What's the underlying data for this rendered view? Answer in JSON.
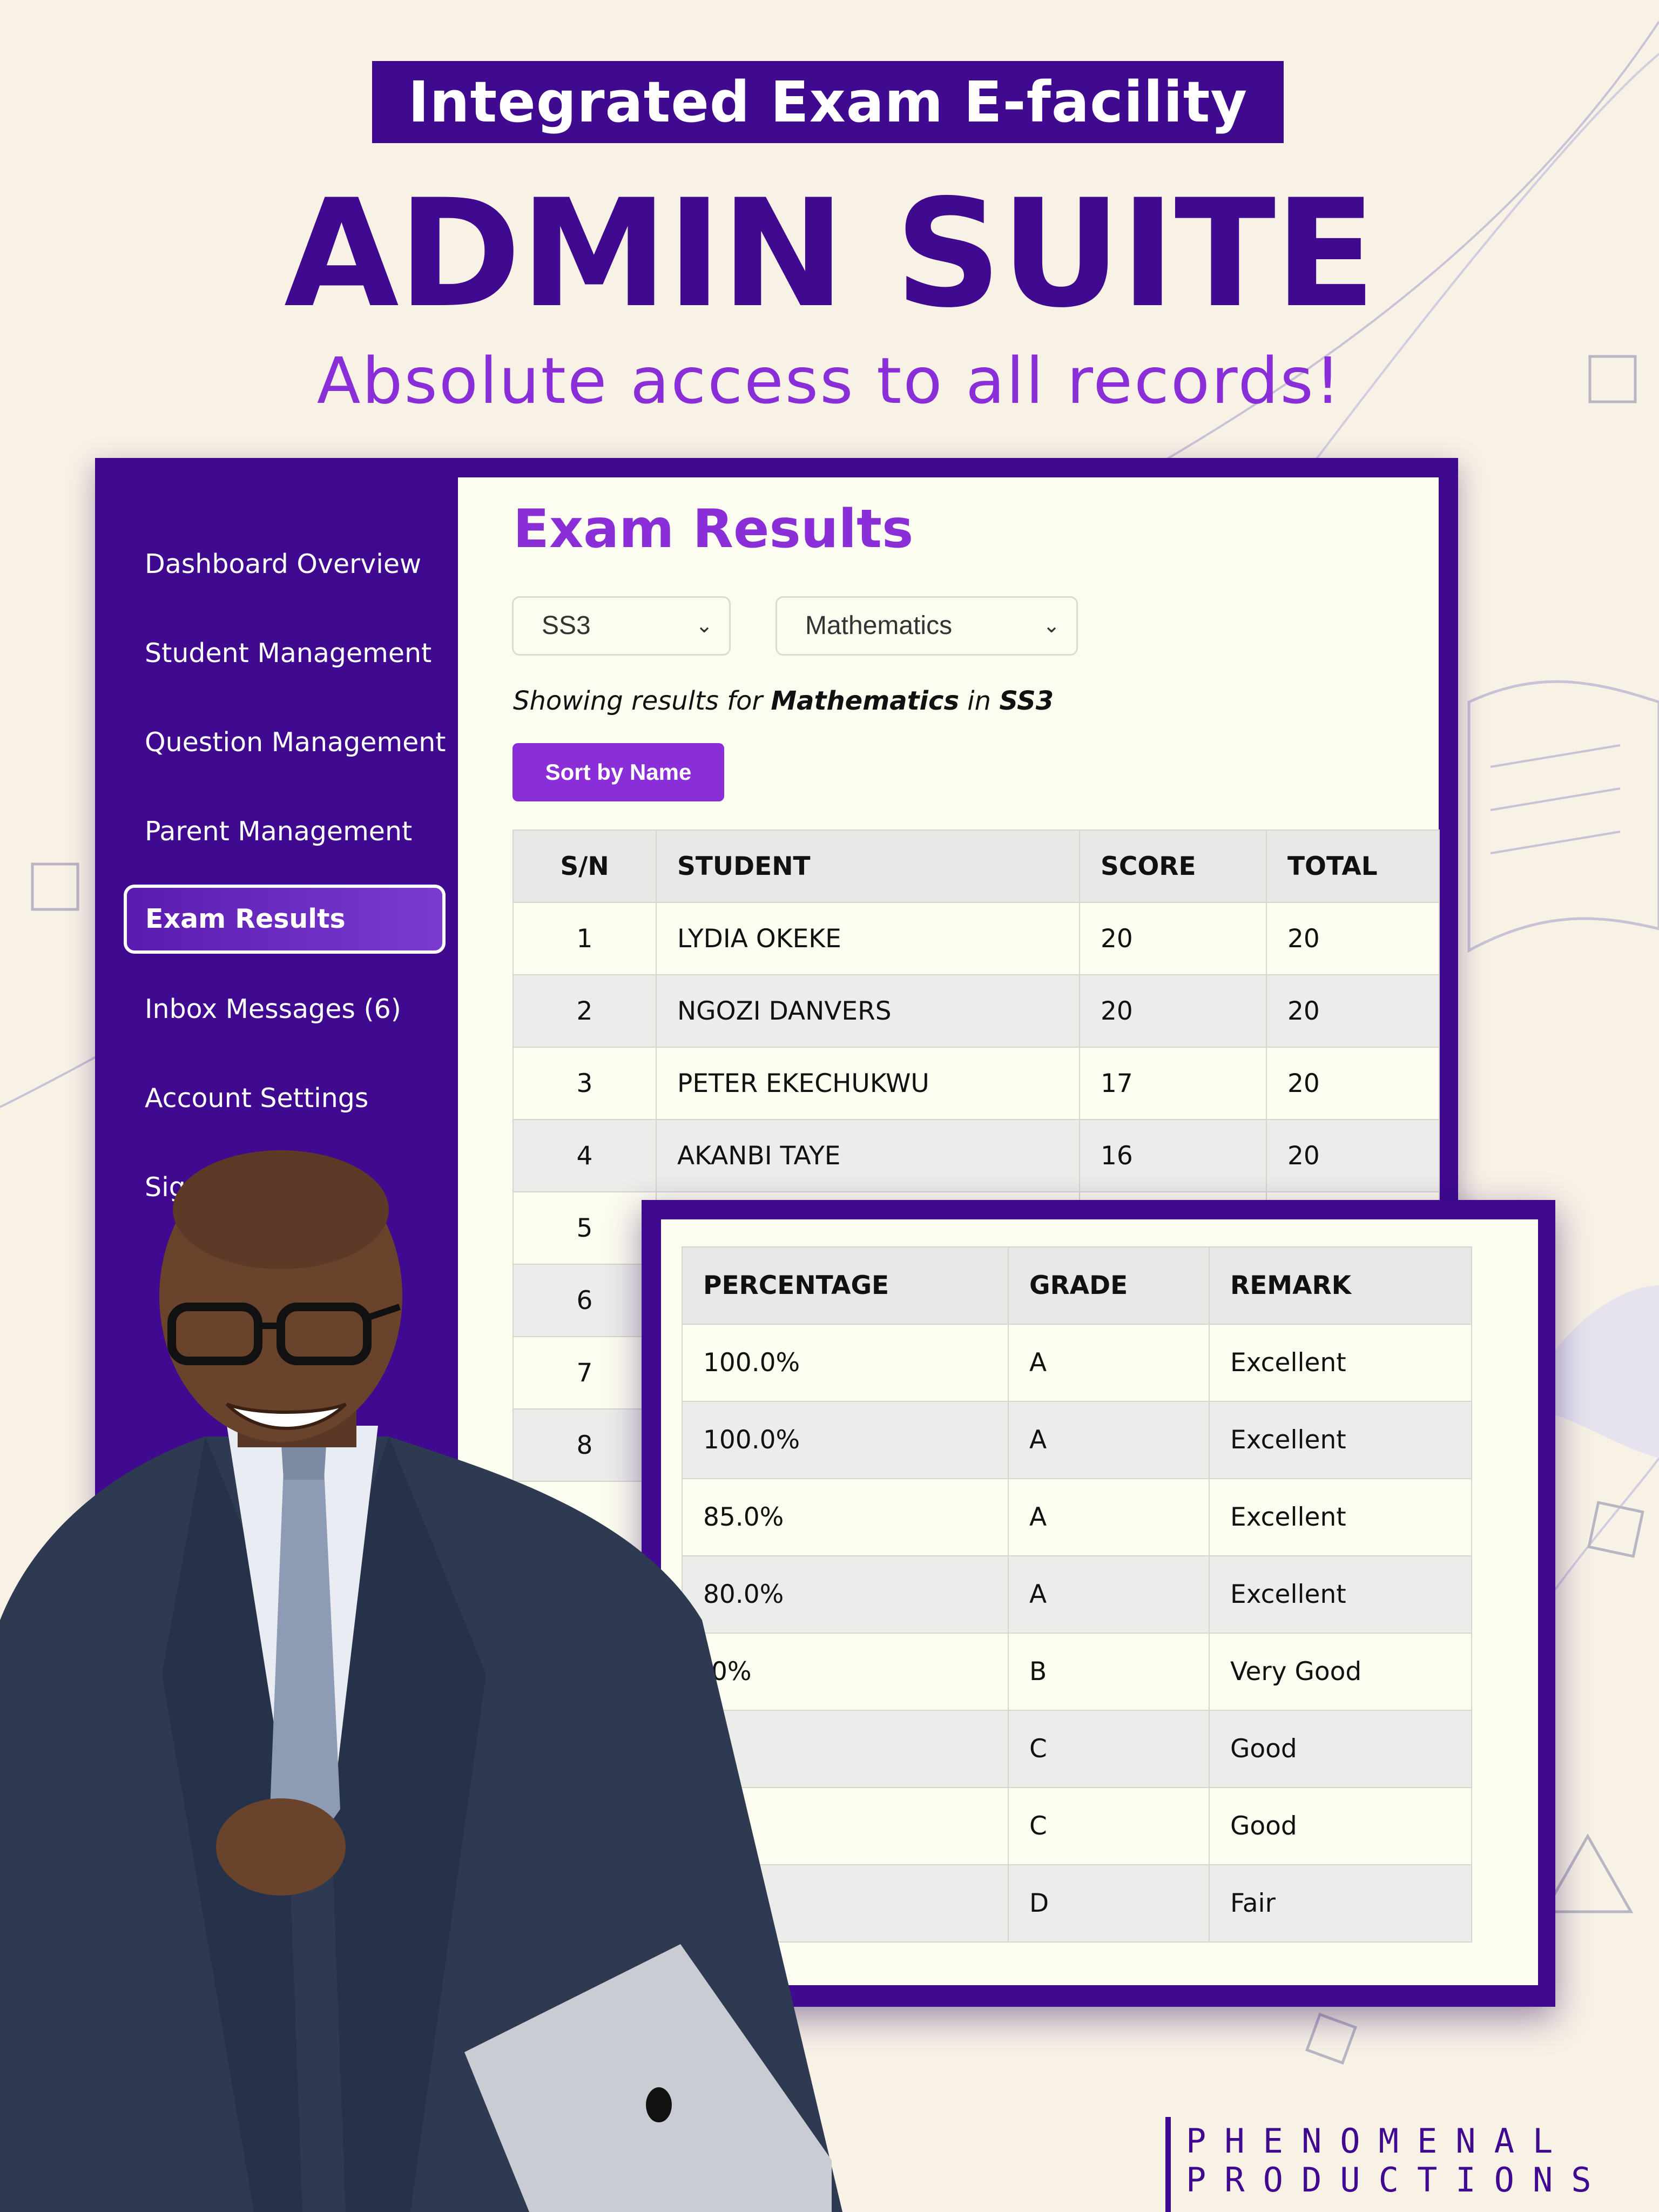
{
  "banner": {
    "tagline": "Integrated Exam E-facility",
    "headline": "ADMIN SUITE",
    "subheadline": "Absolute access to all records!"
  },
  "sidebar": {
    "items": [
      {
        "label": "Dashboard Overview"
      },
      {
        "label": "Student Management"
      },
      {
        "label": "Question Management"
      },
      {
        "label": "Parent Management"
      },
      {
        "label": "Exam Results",
        "active": true
      },
      {
        "label": "Inbox Messages (6)"
      },
      {
        "label": "Account Settings"
      },
      {
        "label": "Sig"
      }
    ]
  },
  "main": {
    "title": "Exam Results",
    "class_select": {
      "value": "SS3"
    },
    "subject_select": {
      "value": "Mathematics"
    },
    "showing": {
      "prefix": "Showing results for ",
      "subject": "Mathematics",
      "mid": " in ",
      "class": "SS3"
    },
    "sort_button": "Sort by Name",
    "table": {
      "headers": [
        "S/N",
        "STUDENT",
        "SCORE",
        "TOTAL"
      ],
      "rows": [
        [
          "1",
          "LYDIA OKEKE",
          "20",
          "20"
        ],
        [
          "2",
          "NGOZI DANVERS",
          "20",
          "20"
        ],
        [
          "3",
          "PETER EKECHUKWU",
          "17",
          "20"
        ],
        [
          "4",
          "AKANBI TAYE",
          "16",
          "20"
        ],
        [
          "5",
          "",
          "",
          ""
        ],
        [
          "6",
          "",
          "",
          ""
        ],
        [
          "7",
          "",
          "",
          ""
        ],
        [
          "8",
          "",
          "",
          ""
        ]
      ]
    }
  },
  "results_panel": {
    "headers": [
      "PERCENTAGE",
      "GRADE",
      "REMARK"
    ],
    "rows": [
      [
        "100.0%",
        "A",
        "Excellent"
      ],
      [
        "100.0%",
        "A",
        "Excellent"
      ],
      [
        "85.0%",
        "A",
        "Excellent"
      ],
      [
        "80.0%",
        "A",
        "Excellent"
      ],
      [
        ".0%",
        "B",
        "Very Good"
      ],
      [
        "",
        "C",
        "Good"
      ],
      [
        "",
        "C",
        "Good"
      ],
      [
        "",
        "D",
        "Fair"
      ]
    ]
  },
  "brand": {
    "line1": "PHENOMENAL",
    "line2": "PRODUCTIONS"
  },
  "colors": {
    "primary": "#3f0a8f",
    "accent": "#8a2fd8",
    "background": "#f8f1e6"
  }
}
